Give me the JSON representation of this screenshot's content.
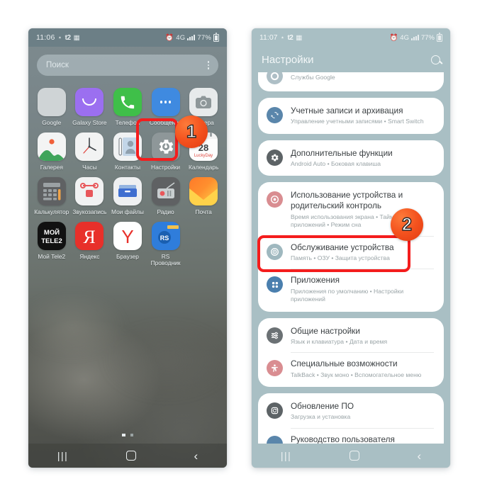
{
  "left_phone": {
    "status": {
      "time": "11:06",
      "network": "t2",
      "battery": "77%"
    },
    "search": {
      "placeholder": "Поиск",
      "menu_icon": "kebab-menu-icon"
    },
    "apps": [
      {
        "label": "Google",
        "icon": "google-folder-icon"
      },
      {
        "label": "Galaxy Store",
        "icon": "galaxy-store-icon"
      },
      {
        "label": "Телефон",
        "icon": "phone-icon"
      },
      {
        "label": "Сообщения",
        "icon": "messages-icon"
      },
      {
        "label": "Камера",
        "icon": "camera-icon"
      },
      {
        "label": "Галерея",
        "icon": "gallery-icon"
      },
      {
        "label": "Часы",
        "icon": "clock-icon"
      },
      {
        "label": "Контакты",
        "icon": "contacts-icon"
      },
      {
        "label": "Настройки",
        "icon": "settings-gear-icon"
      },
      {
        "label": "Календарь",
        "icon": "calendar-icon",
        "day": "28",
        "brand": "LuckyDay"
      },
      {
        "label": "Калькулятор",
        "icon": "calculator-icon"
      },
      {
        "label": "Звукозапись",
        "icon": "voice-recorder-icon"
      },
      {
        "label": "Мои файлы",
        "icon": "my-files-icon"
      },
      {
        "label": "Радио",
        "icon": "radio-icon"
      },
      {
        "label": "Почта",
        "icon": "mail-icon"
      },
      {
        "label": "Мой Tele2",
        "icon": "tele2-icon",
        "art_top": "МОЙ",
        "art_bottom": "TELE2"
      },
      {
        "label": "Яндекс",
        "icon": "yandex-icon",
        "art": "Я"
      },
      {
        "label": "Браузер",
        "icon": "yandex-browser-icon",
        "art": "Y"
      },
      {
        "label": "RS Проводник",
        "icon": "rs-file-explorer-icon",
        "art": "RS"
      }
    ],
    "page_dots": 2,
    "nav": {
      "recents": "recents-button",
      "home": "home-button",
      "back": "back-button"
    }
  },
  "right_phone": {
    "status": {
      "time": "11:07",
      "network": "t2",
      "battery": "77%"
    },
    "header": {
      "title": "Настройки",
      "search_icon": "search-icon"
    },
    "groups": [
      {
        "items": [
          {
            "title": "",
            "sub": "Службы Google",
            "icon": "google-settings-icon",
            "clipped": true
          }
        ]
      },
      {
        "items": [
          {
            "title": "Учетные записи и архивация",
            "sub": "Управление учетными записями  •  Smart Switch",
            "icon": "accounts-backup-icon"
          }
        ]
      },
      {
        "items": [
          {
            "title": "Дополнительные функции",
            "sub": "Android Auto  •  Боковая клавиша",
            "icon": "advanced-features-icon"
          }
        ]
      },
      {
        "items": [
          {
            "title": "Использование устройства и родительский контроль",
            "sub": "Время использования экрана  •  Таймеры приложений  •  Режим сна",
            "icon": "digital-wellbeing-icon"
          },
          {
            "title": "Обслуживание устройства",
            "sub": "Память  •  ОЗУ  •  Защита устройства",
            "icon": "device-care-icon"
          },
          {
            "title": "Приложения",
            "sub": "Приложения по умолчанию  •  Настройки приложений",
            "icon": "apps-icon"
          }
        ]
      },
      {
        "items": [
          {
            "title": "Общие настройки",
            "sub": "Язык и клавиатура  •  Дата и время",
            "icon": "general-management-icon"
          },
          {
            "title": "Специальные возможности",
            "sub": "TalkBack  •  Звук моно  •  Вспомогательное меню",
            "icon": "accessibility-icon"
          }
        ]
      },
      {
        "items": [
          {
            "title": "Обновление ПО",
            "sub": "Загрузка и установка",
            "icon": "software-update-icon"
          },
          {
            "title": "Руководство пользователя",
            "sub": "",
            "icon": "user-manual-icon",
            "clipped": true
          }
        ]
      }
    ],
    "nav": {
      "recents": "recents-button",
      "home": "home-button",
      "back": "back-button"
    }
  },
  "annotations": {
    "step_one": "1",
    "step_two": "2",
    "highlight_color": "#f41d1d",
    "badge_color": "#f4531f"
  }
}
